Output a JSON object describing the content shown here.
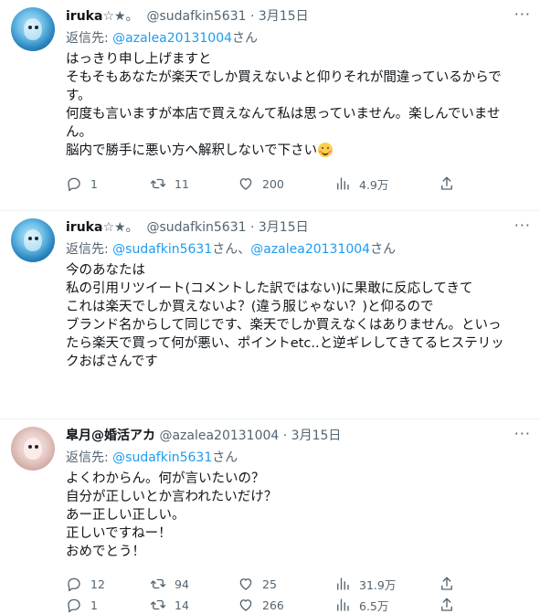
{
  "tweets": [
    {
      "name": "iruka",
      "badge": "☆★。",
      "handle": "@sudafkin5631",
      "date": "3月15日",
      "reply_prefix": "返信先: ",
      "reply_to": [
        "@azalea20131004"
      ],
      "reply_suffix": "さん",
      "lines": [
        "はっきり申し上げますと",
        "そもそもあなたが楽天でしか買えないよと仰りそれが間違っているからで",
        "す。",
        "何度も言いますが本店で買えなんて私は思っていません。楽しんでいませ",
        "ん。",
        "脳内で勝手に悪い方へ解釈しないで下さい"
      ],
      "emoji": "smiling-face-emoji",
      "replies": "1",
      "retweets": "11",
      "likes": "200",
      "views": "4.9万"
    },
    {
      "name": "iruka",
      "badge": "☆★。",
      "handle": "@sudafkin5631",
      "date": "3月15日",
      "reply_prefix": "返信先: ",
      "reply_to": [
        "@sudafkin5631",
        "@azalea20131004"
      ],
      "reply_mid": "さん、",
      "reply_suffix": "さん",
      "lines": [
        "今のあなたは",
        "私の引用リツイート(コメントした訳ではない)に果敢に反応してきて",
        "これは楽天でしか買えないよ？(違う服じゃない？)と仰るので",
        "ブランド名からして同じです、楽天でしか買えなくはありません。といっ",
        "たら楽天で買って何が悪い、ポイントetc..と逆ギレしてきてるヒステリッ",
        "クおばさんです"
      ],
      "replies": "1",
      "retweets": "14",
      "likes": "266",
      "views": "6.5万"
    },
    {
      "name": "皐月@婚活アカ",
      "handle": "@azalea20131004",
      "date": "3月15日",
      "reply_prefix": "返信先: ",
      "reply_to": [
        "@sudafkin5631"
      ],
      "reply_suffix": "さん",
      "lines": [
        "よくわからん。何が言いたいの？",
        "自分が正しいとか言われたいだけ？",
        "あー正しい正しい。",
        "正しいですねー！",
        "おめでとう！"
      ],
      "replies": "12",
      "retweets": "94",
      "likes": "25",
      "views": "31.9万"
    }
  ],
  "more_icon": "more-horizontal-icon",
  "colors": {
    "link": "#1d9bf0",
    "secondary": "#536471",
    "text": "#0f1419",
    "divider": "#eff3f4"
  }
}
